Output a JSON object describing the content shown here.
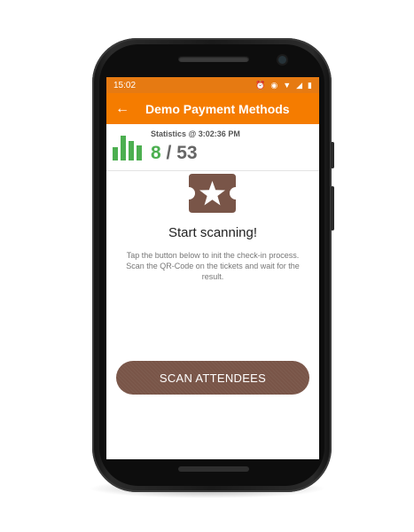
{
  "status_bar": {
    "time": "15:02",
    "icons": [
      "alarm-icon",
      "eye-icon",
      "wifi-icon",
      "signal-icon",
      "battery-icon"
    ]
  },
  "app_bar": {
    "back_icon": "arrow-left-icon",
    "title": "Demo Payment Methods"
  },
  "stats": {
    "label": "Statistics @ 3:02:36 PM",
    "checked_in": "8",
    "separator": "/",
    "total": "53",
    "icon": "bar-chart-icon"
  },
  "main": {
    "icon": "ticket-star-icon",
    "heading": "Start scanning!",
    "description": "Tap the button below to init the check-in process. Scan the QR-Code on the tickets and wait for the result.",
    "button_label": "SCAN ATTENDEES"
  },
  "colors": {
    "status_bar": "#e67a12",
    "app_bar": "#f57c00",
    "accent_green": "#4caf50",
    "brown": "#795548"
  }
}
